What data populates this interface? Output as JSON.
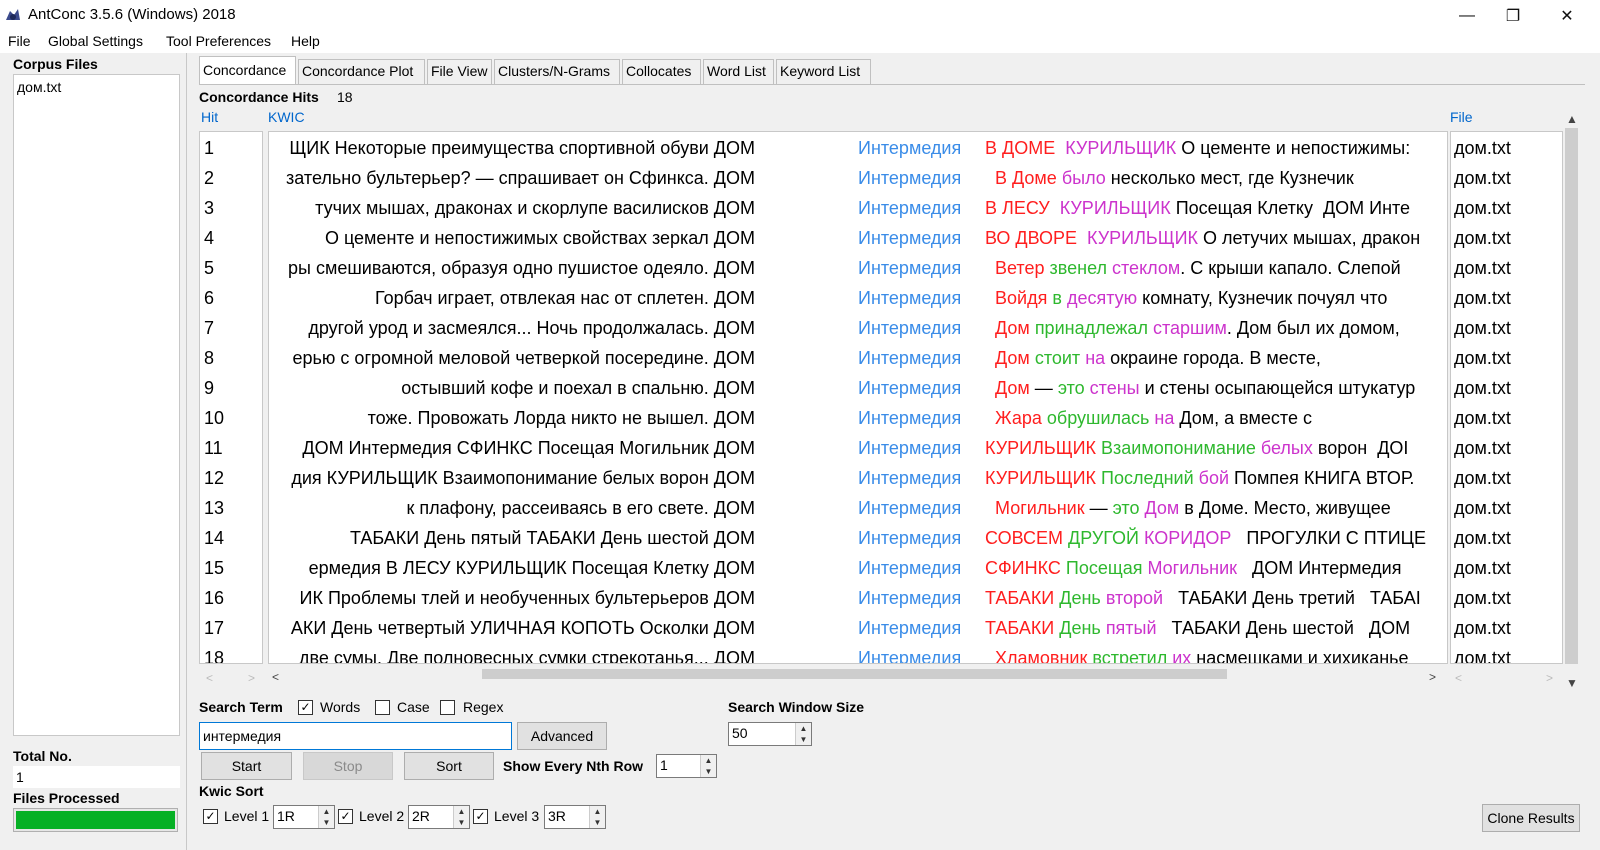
{
  "window": {
    "title": "AntConc 3.5.6 (Windows) 2018",
    "minimize": "—",
    "maximize": "❐",
    "close": "✕"
  },
  "menu": [
    "File",
    "Global Settings",
    "Tool Preferences",
    "Help"
  ],
  "left_panel": {
    "corpus_files_label": "Corpus Files",
    "files": [
      "дом.txt"
    ],
    "total_no_label": "Total No.",
    "total_no_value": "1",
    "files_processed_label": "Files Processed",
    "files_processed_progress": 1.0
  },
  "tabs": [
    "Concordance",
    "Concordance Plot",
    "File View",
    "Clusters/N-Grams",
    "Collocates",
    "Word List",
    "Keyword List"
  ],
  "active_tab": "Concordance",
  "hits": {
    "label": "Concordance Hits",
    "value": "18"
  },
  "columns": {
    "hit": "Hit",
    "kwic": "KWIC",
    "file": "File"
  },
  "rows": [
    {
      "hit": "1",
      "left": "ЩИК Некоторые преимущества спортивной обуви  ДОМ",
      "kw": "Интермедия",
      "right": [
        [
          "c1",
          "В ДОМЕ"
        ],
        [
          "blk",
          "  "
        ],
        [
          "c3",
          "КУРИЛЬЩИК"
        ],
        [
          "blk",
          " О цементе и непостижимы:"
        ]
      ],
      "file": "дом.txt"
    },
    {
      "hit": "2",
      "left": "зательно бультерьер? — спрашивает он Сфинкса. ДОМ",
      "kw": "Интермедия",
      "right": [
        [
          "blk",
          "  "
        ],
        [
          "c1",
          "В Доме"
        ],
        [
          "blk",
          " "
        ],
        [
          "c3",
          "было"
        ],
        [
          "blk",
          " несколько мест, где Кузнечик"
        ]
      ],
      "file": "дом.txt"
    },
    {
      "hit": "3",
      "left": "тучих мышах, драконах и скорлупе василисков  ДОМ",
      "kw": "Интермедия",
      "right": [
        [
          "c1",
          "В ЛЕСУ"
        ],
        [
          "blk",
          "  "
        ],
        [
          "c3",
          "КУРИЛЬЩИК"
        ],
        [
          "blk",
          " Посещая Клетку  ДОМ Инте"
        ]
      ],
      "file": "дом.txt"
    },
    {
      "hit": "4",
      "left": "О цементе и непостижимых свойствах зеркал  ДОМ",
      "kw": "Интермедия",
      "right": [
        [
          "c1",
          "ВО ДВОРЕ"
        ],
        [
          "blk",
          "  "
        ],
        [
          "c3",
          "КУРИЛЬЩИК"
        ],
        [
          "blk",
          " О летучих мышах, дракон"
        ]
      ],
      "file": "дом.txt"
    },
    {
      "hit": "5",
      "left": "ры смешиваются, образуя одно пушистое одеяло. ДОМ",
      "kw": "Интермедия",
      "right": [
        [
          "blk",
          "  "
        ],
        [
          "c1",
          "Ветер"
        ],
        [
          "blk",
          " "
        ],
        [
          "c2",
          "звенел"
        ],
        [
          "blk",
          " "
        ],
        [
          "c3",
          "стеклом"
        ],
        [
          "blk",
          ". С крыши капало. Слепой"
        ]
      ],
      "file": "дом.txt"
    },
    {
      "hit": "6",
      "left": "Горбач играет, отвлекая нас от сплетен. ДОМ",
      "kw": "Интермедия",
      "right": [
        [
          "blk",
          "  "
        ],
        [
          "c1",
          "Войдя"
        ],
        [
          "blk",
          " "
        ],
        [
          "c2",
          "в"
        ],
        [
          "blk",
          " "
        ],
        [
          "c3",
          "десятую"
        ],
        [
          "blk",
          " комнату, Кузнечик почуял что"
        ]
      ],
      "file": "дом.txt"
    },
    {
      "hit": "7",
      "left": "другой урод и засмеялся...  Ночь продолжалась. ДОМ",
      "kw": "Интермедия",
      "right": [
        [
          "blk",
          "  "
        ],
        [
          "c1",
          "Дом"
        ],
        [
          "blk",
          " "
        ],
        [
          "c2",
          "принадлежал"
        ],
        [
          "blk",
          " "
        ],
        [
          "c3",
          "старшим"
        ],
        [
          "blk",
          ". Дом был их домом,"
        ]
      ],
      "file": "дом.txt"
    },
    {
      "hit": "8",
      "left": "ерью с огромной меловой четверкой посередине. ДОМ",
      "kw": "Интермедия",
      "right": [
        [
          "blk",
          "  "
        ],
        [
          "c1",
          "Дом"
        ],
        [
          "blk",
          " "
        ],
        [
          "c2",
          "стоит"
        ],
        [
          "blk",
          " "
        ],
        [
          "c3",
          "на"
        ],
        [
          "blk",
          " окраине города. В месте,"
        ]
      ],
      "file": "дом.txt"
    },
    {
      "hit": "9",
      "left": "остывший кофе и поехал в спальню. ДОМ",
      "kw": "Интермедия",
      "right": [
        [
          "blk",
          "  "
        ],
        [
          "c1",
          "Дом"
        ],
        [
          "blk",
          " — "
        ],
        [
          "c2",
          "это"
        ],
        [
          "blk",
          " "
        ],
        [
          "c3",
          "стены"
        ],
        [
          "blk",
          " и стены осыпающейся штукатур"
        ]
      ],
      "file": "дом.txt"
    },
    {
      "hit": "10",
      "left": "тоже.  Провожать Лорда никто не вышел. ДОМ",
      "kw": "Интермедия",
      "right": [
        [
          "blk",
          "  "
        ],
        [
          "c1",
          "Жара"
        ],
        [
          "blk",
          " "
        ],
        [
          "c2",
          "обрушилась"
        ],
        [
          "blk",
          " "
        ],
        [
          "c3",
          "на"
        ],
        [
          "blk",
          " Дом, а вместе с"
        ]
      ],
      "file": "дом.txt"
    },
    {
      "hit": "11",
      "left": "ДОМ Интермедия   СФИНКС Посещая Могильник  ДОМ",
      "kw": "Интермедия",
      "right": [
        [
          "c1",
          "КУРИЛЬЩИК"
        ],
        [
          "blk",
          " "
        ],
        [
          "c2",
          "Взаимопонимание"
        ],
        [
          "blk",
          " "
        ],
        [
          "c3",
          "белых"
        ],
        [
          "blk",
          " ворон  ДОI"
        ]
      ],
      "file": "дом.txt"
    },
    {
      "hit": "12",
      "left": "дия   КУРИЛЬЩИК Взаимопонимание белых ворон  ДОМ",
      "kw": "Интермедия",
      "right": [
        [
          "c1",
          "КУРИЛЬЩИК"
        ],
        [
          "blk",
          " "
        ],
        [
          "c2",
          "Последний"
        ],
        [
          "blk",
          " "
        ],
        [
          "c3",
          "бой"
        ],
        [
          "blk",
          " Помпея КНИГА ВТОР."
        ]
      ],
      "file": "дом.txt"
    },
    {
      "hit": "13",
      "left": "к плафону, рассеиваясь в его свете. ДОМ",
      "kw": "Интермедия",
      "right": [
        [
          "blk",
          "  "
        ],
        [
          "c1",
          "Могильник"
        ],
        [
          "blk",
          " — "
        ],
        [
          "c2",
          "это"
        ],
        [
          "blk",
          " "
        ],
        [
          "c3",
          "Дом"
        ],
        [
          "blk",
          " в Доме. Место, живущее"
        ]
      ],
      "file": "дом.txt"
    },
    {
      "hit": "14",
      "left": "ТАБАКИ День пятый   ТАБАКИ День шестой  ДОМ",
      "kw": "Интермедия",
      "right": [
        [
          "c1",
          "СОВСЕМ"
        ],
        [
          "blk",
          " "
        ],
        [
          "c2",
          "ДРУГОЙ"
        ],
        [
          "blk",
          " "
        ],
        [
          "c3",
          "КОРИДОР"
        ],
        [
          "blk",
          "   ПРОГУЛКИ С ПТИЦЕ"
        ]
      ],
      "file": "дом.txt"
    },
    {
      "hit": "15",
      "left": "ермедия   В ЛЕСУ  КУРИЛЬЩИК Посещая Клетку  ДОМ",
      "kw": "Интермедия",
      "right": [
        [
          "c1",
          "СФИНКС"
        ],
        [
          "blk",
          " "
        ],
        [
          "c2",
          "Посещая"
        ],
        [
          "blk",
          " "
        ],
        [
          "c3",
          "Могильник"
        ],
        [
          "blk",
          "   ДОМ Интермедия"
        ]
      ],
      "file": "дом.txt"
    },
    {
      "hit": "16",
      "left": "ИК Проблемы тлей и необученных бультерьеров  ДОМ",
      "kw": "Интермедия",
      "right": [
        [
          "c1",
          "ТАБАКИ"
        ],
        [
          "blk",
          " "
        ],
        [
          "c2",
          "День"
        ],
        [
          "blk",
          " "
        ],
        [
          "c3",
          "второй"
        ],
        [
          "blk",
          "   ТАБАКИ День третий   ТАБАI"
        ]
      ],
      "file": "дом.txt"
    },
    {
      "hit": "17",
      "left": "АКИ День четвертый   УЛИЧНАЯ КОПОТЬ Осколки  ДОМ",
      "kw": "Интермедия",
      "right": [
        [
          "c1",
          "ТАБАКИ"
        ],
        [
          "blk",
          " "
        ],
        [
          "c2",
          "День"
        ],
        [
          "blk",
          " "
        ],
        [
          "c3",
          "пятый"
        ],
        [
          "blk",
          "   ТАБАКИ День шестой   ДОМ"
        ]
      ],
      "file": "дом.txt"
    },
    {
      "hit": "18",
      "left": "две сумы. Две полновесных сумки стрекотанья... ДОМ",
      "kw": "Интермедия",
      "right": [
        [
          "blk",
          "  "
        ],
        [
          "c1",
          "Хламовник"
        ],
        [
          "blk",
          " "
        ],
        [
          "c2",
          "встретил"
        ],
        [
          "blk",
          " "
        ],
        [
          "c3",
          "их"
        ],
        [
          "blk",
          " насмешками и хихиканье"
        ]
      ],
      "file": "дом.txt"
    }
  ],
  "search": {
    "term_label": "Search Term",
    "words_label": "Words",
    "words_checked": true,
    "case_label": "Case",
    "case_checked": false,
    "regex_label": "Regex",
    "regex_checked": false,
    "value": "интермедия",
    "advanced_label": "Advanced",
    "window_size_label": "Search Window Size",
    "window_size_value": "50"
  },
  "buttons": {
    "start": "Start",
    "stop": "Stop",
    "sort": "Sort",
    "clone": "Clone Results"
  },
  "nth_row": {
    "label": "Show Every Nth Row",
    "value": "1"
  },
  "kwic_sort": {
    "label": "Kwic Sort",
    "levels": [
      {
        "label": "Level 1",
        "value": "1R",
        "checked": true
      },
      {
        "label": "Level 2",
        "value": "2R",
        "checked": true
      },
      {
        "label": "Level 3",
        "value": "3R",
        "checked": true
      }
    ]
  }
}
